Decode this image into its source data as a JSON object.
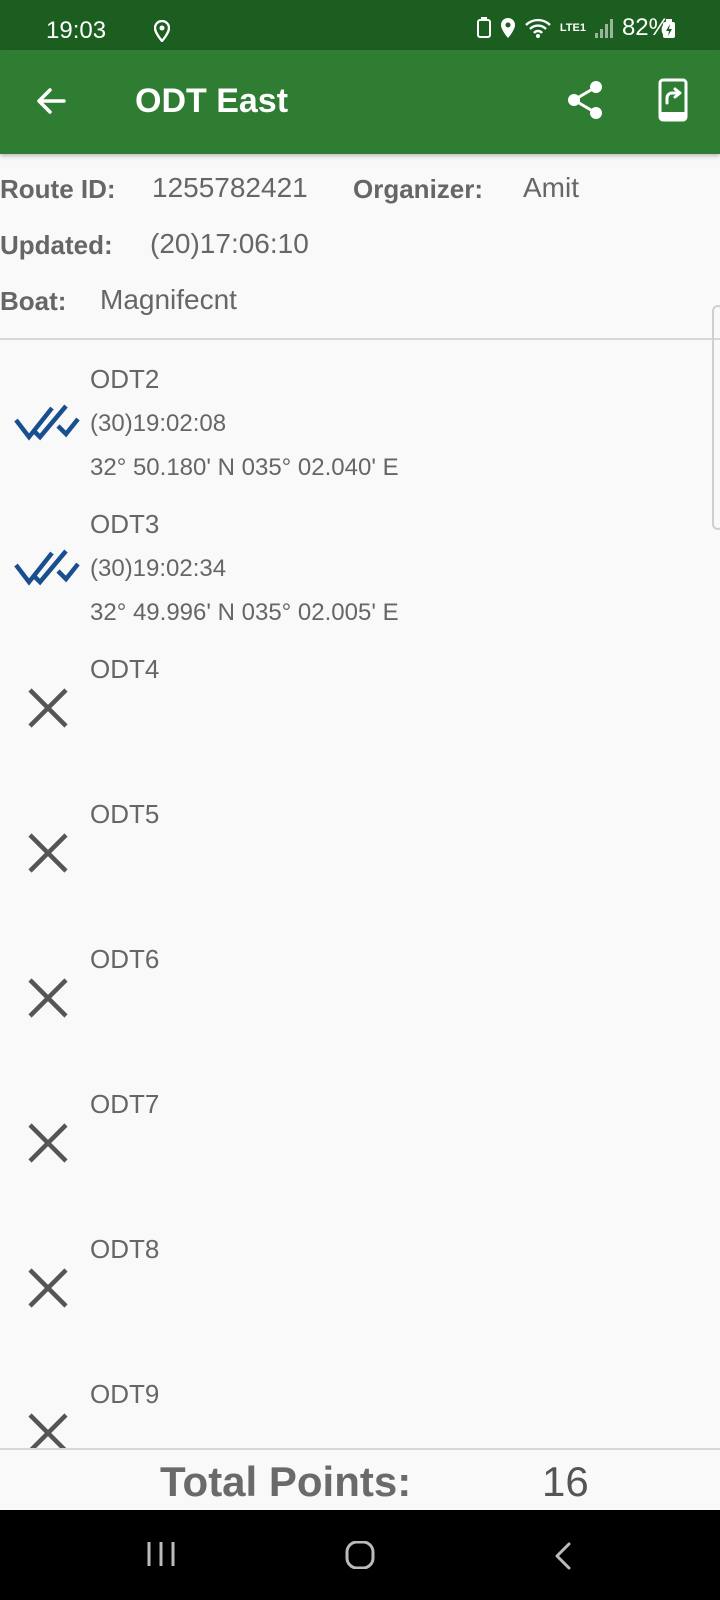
{
  "status_bar": {
    "time": "19:03",
    "battery": "82%",
    "network": "LTE1"
  },
  "app_bar": {
    "title": "ODT East",
    "back_icon": "arrow-left-icon",
    "share_icon": "share-icon",
    "export_icon": "export-icon"
  },
  "info": {
    "route_id_label": "Route ID:",
    "route_id": "1255782421",
    "organizer_label": "Organizer:",
    "organizer": "Amit",
    "updated_label": "Updated:",
    "updated": "(20)17:06:10",
    "boat_label": "Boat:",
    "boat": "Magnifecnt"
  },
  "waypoints": [
    {
      "name": "ODT2",
      "time": "(30)19:02:08",
      "coords": "32° 50.180' N 035° 02.040' E",
      "status": "reached"
    },
    {
      "name": "ODT3",
      "time": "(30)19:02:34",
      "coords": "32° 49.996' N 035° 02.005' E",
      "status": "reached"
    },
    {
      "name": "ODT4",
      "time": "",
      "coords": "",
      "status": "missed"
    },
    {
      "name": "ODT5",
      "time": "",
      "coords": "",
      "status": "missed"
    },
    {
      "name": "ODT6",
      "time": "",
      "coords": "",
      "status": "missed"
    },
    {
      "name": "ODT7",
      "time": "",
      "coords": "",
      "status": "missed"
    },
    {
      "name": "ODT8",
      "time": "",
      "coords": "",
      "status": "missed"
    },
    {
      "name": "ODT9",
      "time": "",
      "coords": "",
      "status": "missed"
    }
  ],
  "total": {
    "label": "Total Points:",
    "value": "16"
  },
  "colors": {
    "status_bar": "#1b5e20",
    "app_bar": "#2e7d32",
    "check": "#1a4f8f",
    "cross": "#555555",
    "text": "#666666"
  }
}
